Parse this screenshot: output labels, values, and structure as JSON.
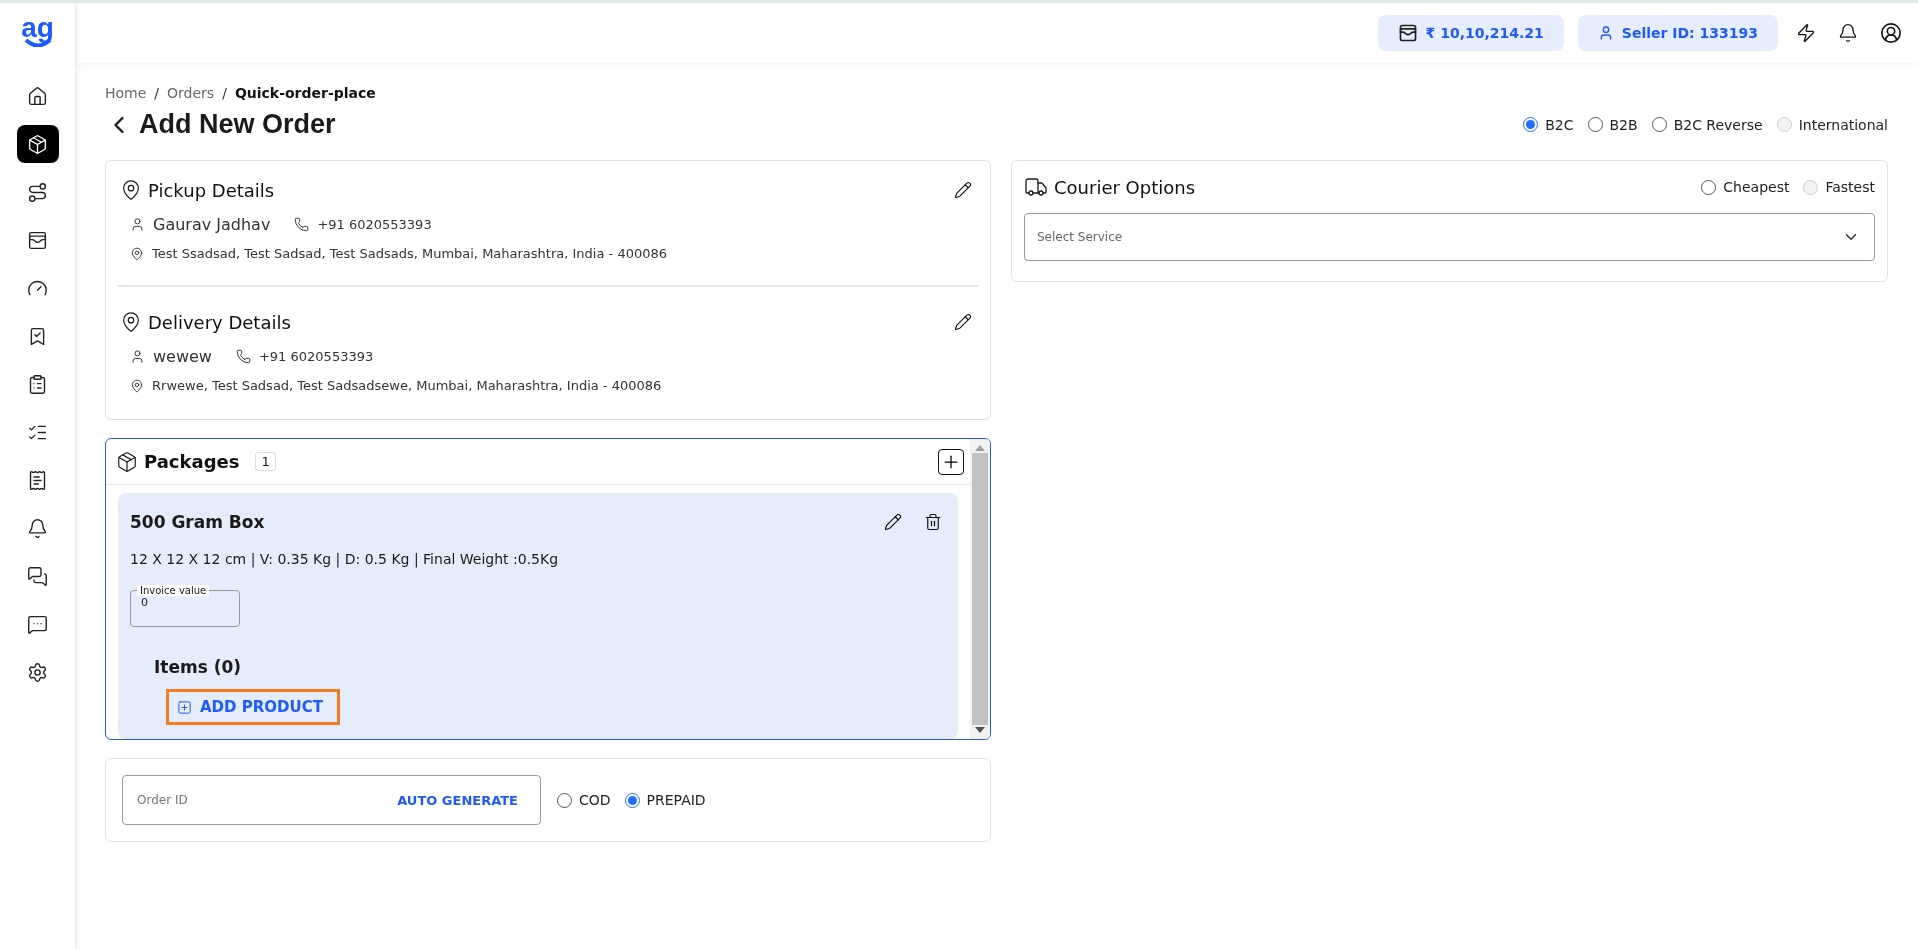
{
  "sidebar": {
    "logo": "ag",
    "items": [
      {
        "selected": false
      },
      {
        "selected": true
      },
      {
        "selected": false
      },
      {
        "selected": false
      },
      {
        "selected": false
      },
      {
        "selected": false
      },
      {
        "selected": false
      },
      {
        "selected": false
      },
      {
        "selected": false
      },
      {
        "selected": false
      },
      {
        "selected": false
      },
      {
        "selected": false
      },
      {
        "selected": false
      }
    ]
  },
  "header": {
    "balance": "₹ 10,10,214.21",
    "seller_id": "Seller ID: 133193"
  },
  "breadcrumb": [
    {
      "label": "Home",
      "current": false
    },
    {
      "separator": "/"
    },
    {
      "label": "Orders",
      "current": false
    },
    {
      "separator": "/"
    },
    {
      "label": "Quick-order-place",
      "current": true
    }
  ],
  "page_title": "Add New Order",
  "order_types": [
    {
      "label": "B2C",
      "selected": true,
      "disabled": false
    },
    {
      "label": "B2B",
      "selected": false,
      "disabled": false
    },
    {
      "label": "B2C Reverse",
      "selected": false,
      "disabled": false
    },
    {
      "label": "International",
      "selected": false,
      "disabled": true
    }
  ],
  "addresses": [
    {
      "title": "Pickup Details",
      "name": "Gaurav Jadhav",
      "phone": "+91 6020553393",
      "address": "Test Ssadsad, Test Sadsad, Test Sadsads, Mumbai, Maharashtra, India - 400086"
    },
    {
      "title": "Delivery Details",
      "name": "wewew",
      "phone": "+91 6020553393",
      "address": "Rrwewe, Test Sadsad, Test Sadsadsewe, Mumbai, Maharashtra, India - 400086"
    }
  ],
  "packages": {
    "title": "Packages",
    "count": "1",
    "items": [
      {
        "name": "500 Gram Box",
        "specs": "12 X 12 X 12 cm | V: 0.35 Kg | D: 0.5 Kg | Final Weight :0.5Kg",
        "invoice_label": "Invoice value",
        "invoice_value": "0",
        "items_title": "Items (0)",
        "add_product": "ADD PRODUCT",
        "highlighted": true
      }
    ]
  },
  "order": {
    "order_id_placeholder": "Order ID",
    "auto_generate": "AUTO GENERATE",
    "payment": [
      {
        "label": "COD",
        "selected": false
      },
      {
        "label": "PREPAID",
        "selected": true
      }
    ]
  },
  "courier": {
    "title": "Courier Options",
    "sort": [
      {
        "label": "Cheapest",
        "selected": false,
        "disabled": false
      },
      {
        "label": "Fastest",
        "selected": false,
        "disabled": true
      }
    ],
    "select_placeholder": "Select Service"
  }
}
